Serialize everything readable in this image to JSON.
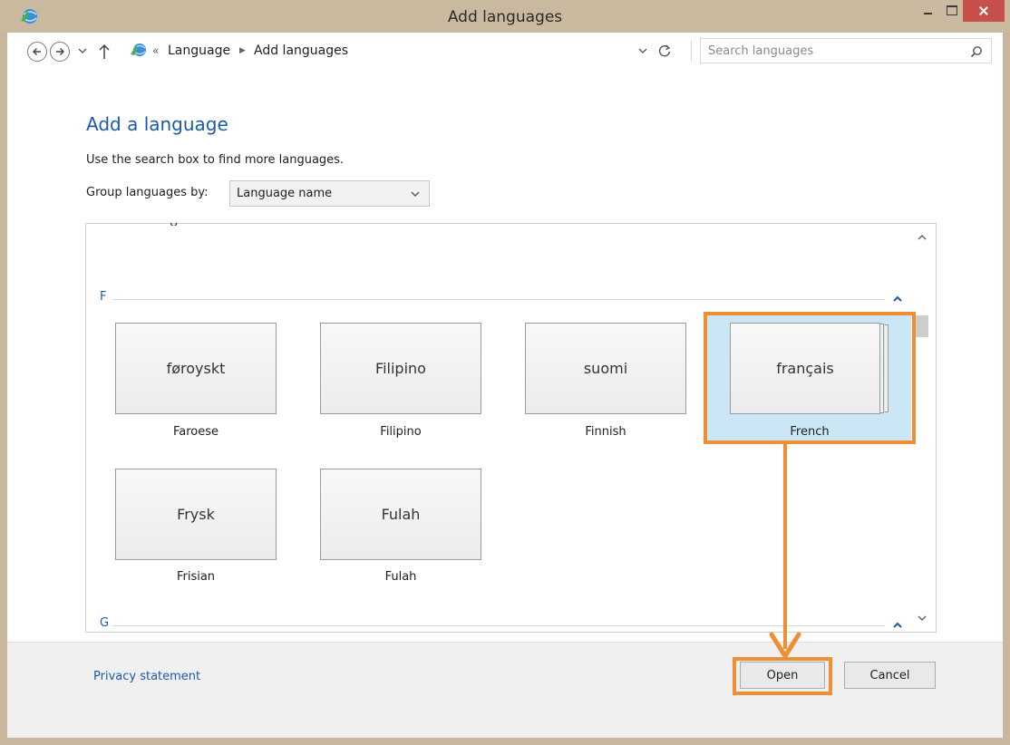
{
  "window": {
    "title": "Add languages",
    "icon": "language-globe-icon",
    "accent": "#c9b99f"
  },
  "address_bar": {
    "overflow_marker": "«",
    "crumbs": [
      "Language",
      "Add languages"
    ]
  },
  "search": {
    "placeholder": "Search languages",
    "value": ""
  },
  "content": {
    "heading": "Add a language",
    "instruction": "Use the search box to find more languages.",
    "group_by_label": "Group languages by:",
    "group_by_value": "Language name"
  },
  "language_groups": [
    {
      "letter": "F",
      "languages": [
        {
          "native": "føroyskt",
          "english": "Faroese",
          "selected": false
        },
        {
          "native": "Filipino",
          "english": "Filipino",
          "selected": false
        },
        {
          "native": "suomi",
          "english": "Finnish",
          "selected": false
        },
        {
          "native": "français",
          "english": "French",
          "selected": true
        },
        {
          "native": "Frysk",
          "english": "Frisian",
          "selected": false
        },
        {
          "native": "Fulah",
          "english": "Fulah",
          "selected": false
        }
      ]
    },
    {
      "letter": "G",
      "languages": []
    }
  ],
  "footer": {
    "privacy_link": "Privacy statement",
    "open_label": "Open",
    "cancel_label": "Cancel"
  },
  "colors": {
    "link_blue": "#1c5aa8",
    "selection_blue": "#cbe6f5",
    "annotation_orange": "#ef8f33",
    "close_red": "#c7504b"
  }
}
